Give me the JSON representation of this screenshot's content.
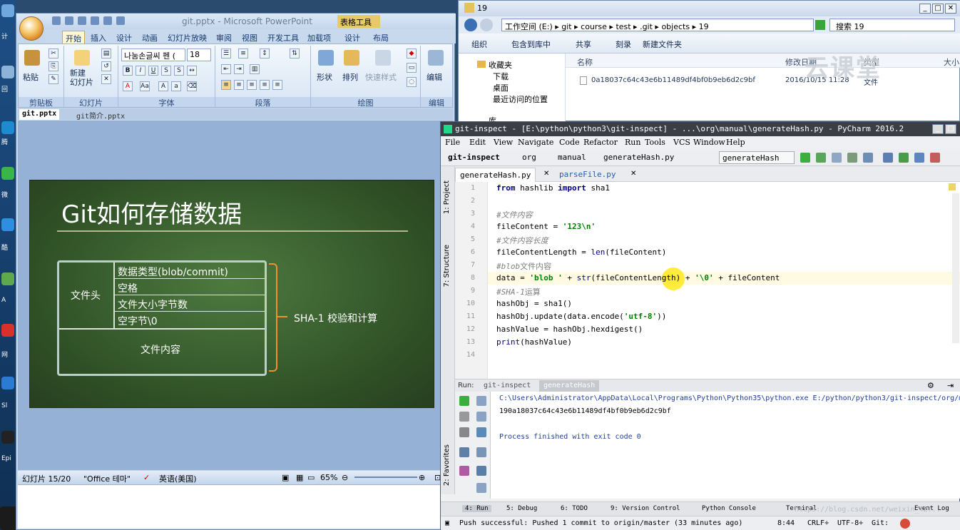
{
  "desktop": {
    "labels": [
      "计",
      "回",
      "腾",
      "微",
      "酷",
      "A",
      "网",
      "Sl",
      "Epi"
    ]
  },
  "ppt": {
    "title": "git.pptx - Microsoft PowerPoint",
    "context_tab": "表格工具",
    "tabs": [
      "开始",
      "插入",
      "设计",
      "动画",
      "幻灯片放映",
      "审阅",
      "视图",
      "开发工具",
      "加载项",
      "设计",
      "布局"
    ],
    "ribbon": {
      "paste": "粘贴",
      "new_slide": "新建\n幻灯片",
      "font_name": "나눔손글씨 펜 (",
      "font_size": "18",
      "groups": [
        "剪贴板",
        "幻灯片",
        "字体",
        "段落",
        "绘图",
        "编辑"
      ],
      "shape": "形状",
      "arrange": "排列",
      "quick_style": "快速样式",
      "edit": "编辑"
    },
    "doc_tabs": [
      "git.pptx",
      "git简介.pptx"
    ],
    "slide": {
      "title": "Git如何存储数据",
      "header_label": "文件头",
      "rows": [
        "数据类型(blob/commit)",
        "空格",
        "文件大小字节数",
        "空字节\\0"
      ],
      "content_label": "文件内容",
      "brace_label": "SHA-1 校验和计算"
    },
    "status": {
      "slide": "幻灯片 15/20",
      "theme": "\"Office 테마\"",
      "lang": "英语(美国)",
      "zoom": "65%"
    }
  },
  "explorer": {
    "title": "19",
    "address": [
      "工作空间 (E:)",
      "git",
      "course",
      "test",
      ".git",
      "objects",
      "19"
    ],
    "search": "搜索 19",
    "toolbar": [
      "组织",
      "包含到库中",
      "共享",
      "刻录",
      "新建文件夹"
    ],
    "nav": [
      "收藏夹",
      "下载",
      "桌面",
      "最近访问的位置",
      "库"
    ],
    "columns": [
      "名称",
      "修改日期",
      "类型",
      "大小"
    ],
    "file": {
      "name": "0a18037c64c43e6b11489df4bf0b9eb6d2c9bf",
      "date": "2016/10/15 11:28",
      "type": "文件"
    },
    "watermark": "云课堂"
  },
  "pycharm": {
    "title": "git-inspect - [E:\\python\\python3\\git-inspect] - ...\\org\\manual\\generateHash.py - PyCharm 2016.2",
    "menu": [
      "File",
      "Edit",
      "View",
      "Navigate",
      "Code",
      "Refactor",
      "Run",
      "Tools",
      "VCS",
      "Window",
      "Help"
    ],
    "breadcrumbs": [
      "git-inspect",
      "org",
      "manual",
      "generateHash.py"
    ],
    "run_config": "generateHash",
    "editor_tabs": [
      "generateHash.py",
      "parseFile.py"
    ],
    "side_labels": [
      "1: Project",
      "7: Structure",
      "2: Favorites"
    ],
    "line_numbers": [
      "1",
      "2",
      "3",
      "4",
      "5",
      "6",
      "7",
      "8",
      "9",
      "10",
      "11",
      "12",
      "13",
      "14"
    ],
    "code": {
      "l1_kw1": "from",
      "l1_mid": " hashlib ",
      "l1_kw2": "import",
      "l1_end": " sha1",
      "l3": "#文件内容",
      "l4_a": "fileContent = ",
      "l4_s": "'123\\n'",
      "l5": "#文件内容长度",
      "l6_a": "fileContentLength = ",
      "l6_b": "len",
      "l6_c": "(fileContent)",
      "l7_a": "#",
      "l7_b": "blob",
      "l7_c": "文件内容",
      "l8_a": "data = ",
      "l8_s": "'blob '",
      "l8_b": " + ",
      "l8_c": "str",
      "l8_d": "(fileContentLength) + ",
      "l8_s2": "'\\0'",
      "l8_e": " + fileContent",
      "l9_a": "#",
      "l9_b": "SHA-1",
      "l9_c": "运算",
      "l10": "hashObj = sha1()",
      "l11_a": "hashObj.update(data.encode(",
      "l11_s": "'utf-8'",
      "l11_b": "))",
      "l12": "hashValue = hashObj.hexdigest()",
      "l13_a": "print",
      "l13_b": "(hashValue)"
    },
    "run": {
      "label": "Run:",
      "tabs": [
        "git-inspect",
        "generateHash"
      ],
      "lines": [
        "C:\\Users\\Administrator\\AppData\\Local\\Programs\\Python\\Python35\\python.exe E:/python/python3/git-inspect/org/man",
        "190a18037c64c43e6b11489df4bf0b9eb6d2c9bf",
        "",
        "Process finished with exit code 0"
      ]
    },
    "bottom_tabs": [
      "4: Run",
      "5: Debug",
      "6: TODO",
      "9: Version Control",
      "Python Console",
      "Terminal",
      "Event Log"
    ],
    "status": {
      "message": "Push successful: Pushed 1 commit to origin/master (33 minutes ago)",
      "pos": "8:44",
      "crlf": "CRLF÷",
      "enc": "UTF-8÷",
      "git": "Git:"
    },
    "url_watermark": "https://blog.csdn.net/weixin_42..."
  }
}
